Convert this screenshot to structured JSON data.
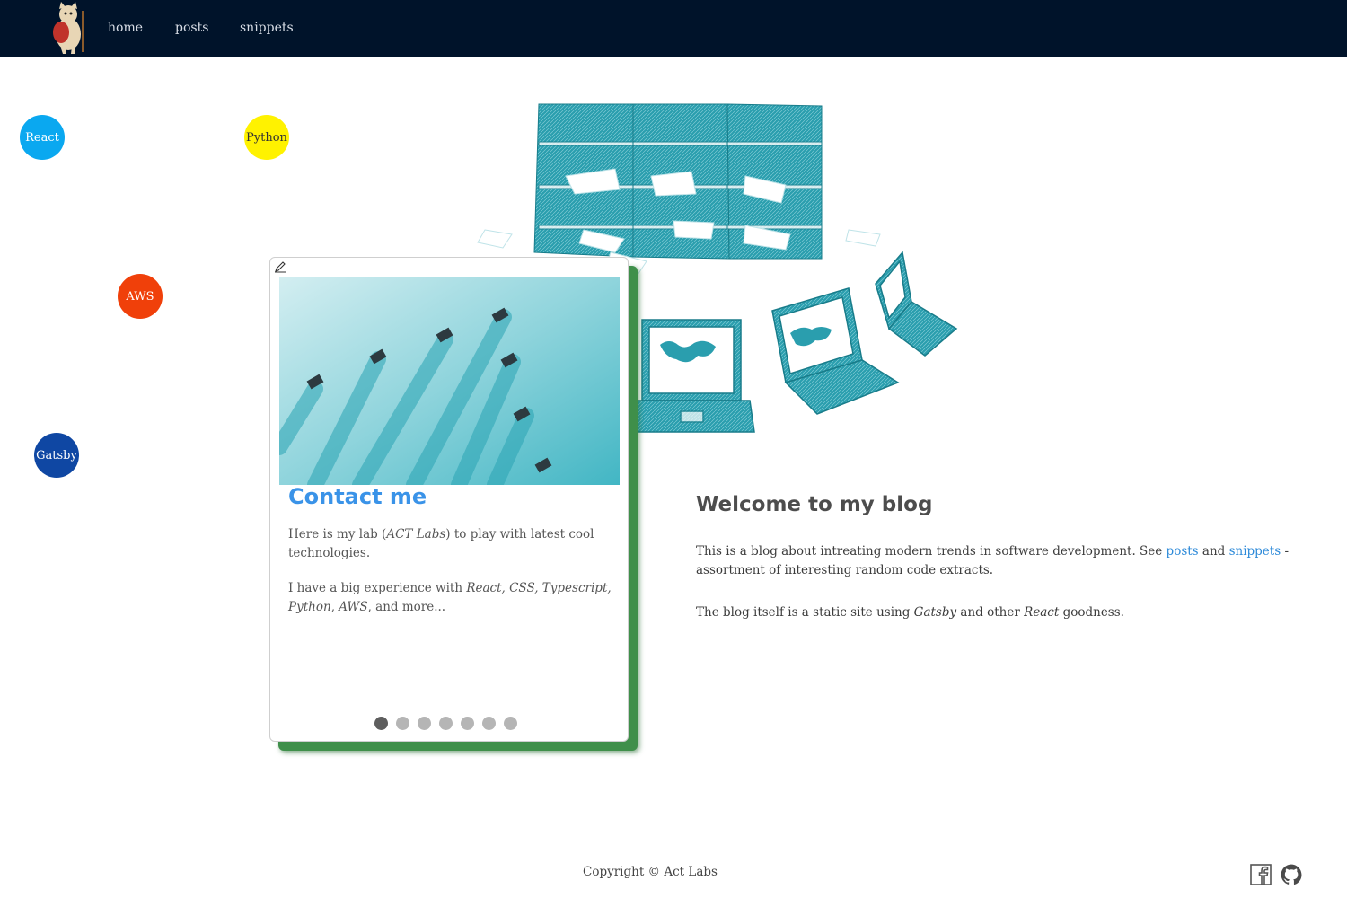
{
  "nav": {
    "home": "home",
    "posts": "posts",
    "snippets": "snippets"
  },
  "bubbles": [
    {
      "label": "React",
      "bg": "#0aa8f0",
      "fg": "#ffffff"
    },
    {
      "label": "Python",
      "bg": "#fff200",
      "fg": "#333333"
    },
    {
      "label": "AWS",
      "bg": "#f0400a",
      "fg": "#ffffff"
    },
    {
      "label": "Gatsby",
      "bg": "#0f47a3",
      "fg": "#ffffff"
    }
  ],
  "card": {
    "edit_icon": "pencil-icon",
    "title": "Contact me",
    "p1_a": "Here is my lab (",
    "p1_em": "ACT Labs",
    "p1_b": ") to play with latest cool technologies.",
    "p2_a": "I have a big experience with ",
    "p2_em": "React, CSS, Typescript, Python, AWS",
    "p2_b": ", and more...",
    "slide_count": 7,
    "active_slide": 1
  },
  "welcome": {
    "title": "Welcome to my blog",
    "p1_a": "This is a blog about intreating modern trends in software development. See ",
    "p1_posts": "posts",
    "p1_and": " and ",
    "p1_snippets": "snippets",
    "p1_b": " - assortment of interesting random code extracts.",
    "p2_a": "The blog itself is a static site using ",
    "p2_em1": "Gatsby",
    "p2_mid": " and other ",
    "p2_em2": "React",
    "p2_b": " goodness."
  },
  "footer": {
    "copyright": "Copyright © Act Labs",
    "icons": [
      "facebook-icon",
      "github-icon"
    ]
  },
  "colors": {
    "nav_bg": "#00132a",
    "accent": "#3a93e8",
    "illustration": "#1f9bab",
    "card_shadow": "#3f8f4a"
  }
}
